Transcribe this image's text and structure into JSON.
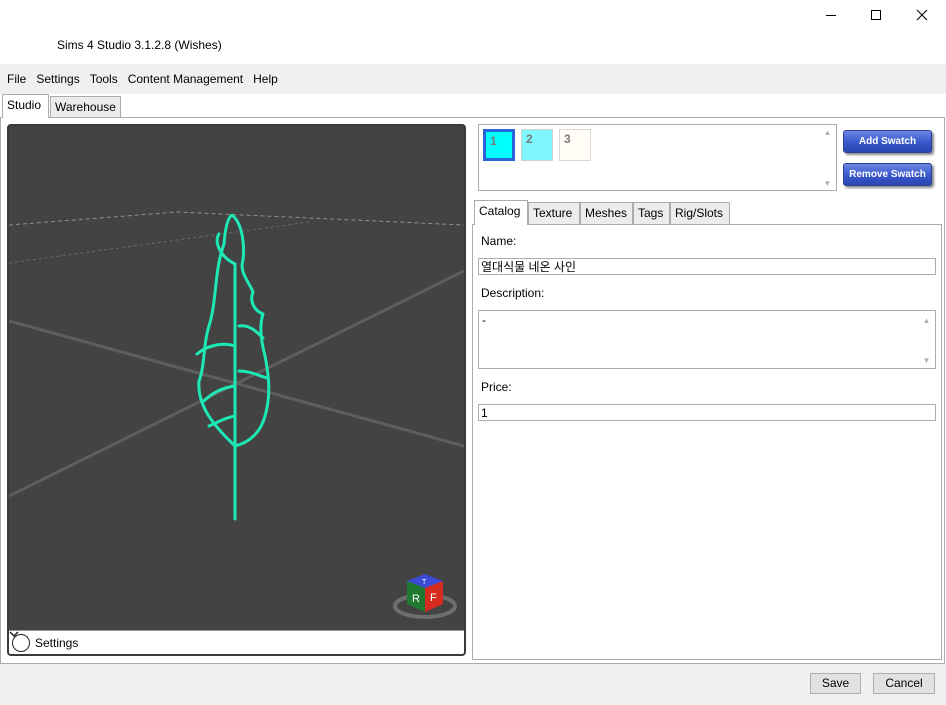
{
  "window": {
    "title": "Sims 4 Studio 3.1.2.8 (Wishes)",
    "minimize_icon": "minimize-icon",
    "maximize_icon": "maximize-icon",
    "close_icon": "close-icon"
  },
  "menu": [
    "File",
    "Settings",
    "Tools",
    "Content Management",
    "Help"
  ],
  "top_tabs": {
    "studio": "Studio",
    "warehouse": "Warehouse"
  },
  "viewport": {
    "settings_label": "Settings",
    "gizmo_labels": {
      "right": "R",
      "front": "F",
      "top": "T"
    },
    "background": "#434343",
    "object_color": "#1de9b6"
  },
  "swatches": [
    {
      "label": "1",
      "color": "#00ffff",
      "selected": true
    },
    {
      "label": "2",
      "color": "#7ff7ff",
      "selected": false
    },
    {
      "label": "3",
      "color": "#fffdf5",
      "selected": false
    }
  ],
  "buttons": {
    "add_swatch": "Add Swatch",
    "remove_swatch": "Remove Swatch",
    "save": "Save",
    "cancel": "Cancel"
  },
  "inner_tabs": [
    "Catalog",
    "Texture",
    "Meshes",
    "Tags",
    "Rig/Slots"
  ],
  "catalog": {
    "name_label": "Name:",
    "name_value": "열대식물 네온 사인",
    "description_label": "Description:",
    "description_value": "-",
    "price_label": "Price:",
    "price_value": "1"
  }
}
